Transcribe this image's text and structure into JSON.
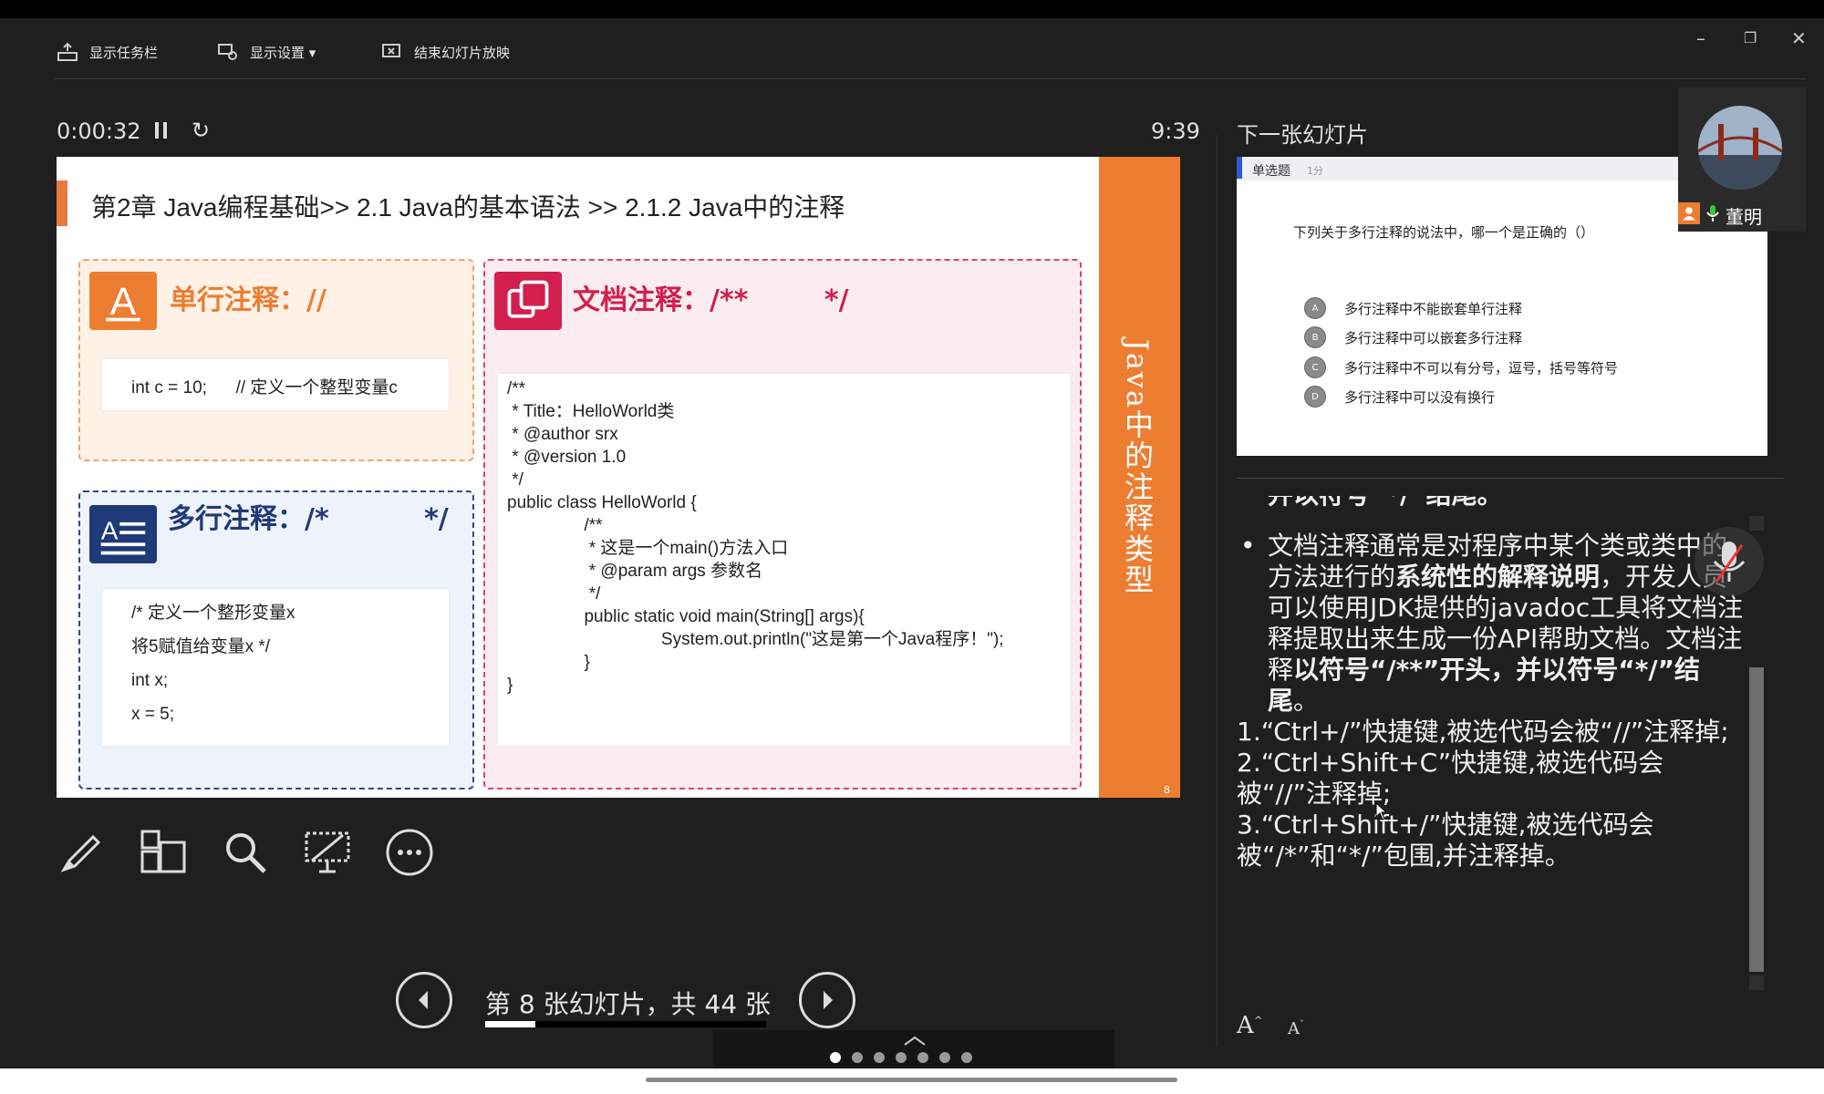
{
  "toolbar": {
    "show_taskbar": "显示任务栏",
    "display_settings": "显示设置 ▾",
    "end_slideshow": "结束幻灯片放映",
    "minimize": "–",
    "restore": "❐",
    "close": "✕"
  },
  "presenter": {
    "elapsed": "0:00:32",
    "clock": "9:39",
    "refresh_glyph": "↻"
  },
  "slide": {
    "title": "第2章 Java编程基础>> 2.1 Java的基本语法 >> 2.1.2 Java中的注释",
    "side_text": "Java中的注释类型",
    "number": "8",
    "single_line": {
      "heading": "单行注释：//",
      "code": "int c = 10;      // 定义一个整型变量c"
    },
    "multi_line": {
      "heading": "多行注释：/*          */",
      "code": [
        "/* 定义一个整形变量x",
        "将5赋值给变量x */",
        "int x;",
        "x = 5;"
      ]
    },
    "doc": {
      "heading": "文档注释：/**        */",
      "code": [
        "/**",
        " * Title：HelloWorld类",
        " * @author srx",
        " * @version 1.0",
        " */",
        "public class HelloWorld {",
        "                /**",
        "                 * 这是一个main()方法入口",
        "                 * @param args 参数名",
        "                 */",
        "                public static void main(String[] args){",
        "                                System.out.println(\"这是第一个Java程序！\");",
        "                }",
        "}"
      ]
    }
  },
  "navigation": {
    "slide_counter": "第 8 张幻灯片，共 44 张",
    "progress": 0.18
  },
  "next_slide": {
    "label": "下一张幻灯片",
    "question_type": "单选题",
    "score": "1分",
    "question": "下列关于多行注释的说法中，哪一个是正确的（）",
    "options": [
      {
        "letter": "A",
        "text": "多行注释中不能嵌套单行注释"
      },
      {
        "letter": "B",
        "text": "多行注释中可以嵌套多行注释"
      },
      {
        "letter": "C",
        "text": "多行注释中不可以有分号，逗号，括号等符号"
      },
      {
        "letter": "D",
        "text": "多行注释中可以没有换行"
      }
    ]
  },
  "notes": {
    "cut_line": "并以符号“*/”结尾。",
    "bullet_pre": "文档注释通常是对程序中某个类或类中的方法进行的",
    "bullet_bold1": "系统性的解释说明",
    "bullet_mid": "，开发人员可以使用JDK提供的javadoc工具将文档注释提取出来生成一份API帮助文档。文档注释",
    "bullet_bold2": "以符号“/**”开头，并以符号“*/”结尾",
    "bullet_end": "。",
    "line1": "1.“Ctrl+/”快捷键,被选代码会被“//”注释掉;",
    "line2": "2.“Ctrl+Shift+C”快捷键,被选代码会被“//”注释掉;",
    "line3": "3.“Ctrl+Shift+/”快捷键,被选代码会被“/*”和“*/”包围,并注释掉。"
  },
  "font_controls": {
    "increase": "A",
    "decrease": "A"
  },
  "webcam": {
    "name": "董明"
  },
  "colors": {
    "orange": "#ed7d31",
    "navy": "#1f3a78",
    "crimson": "#d21f4e"
  }
}
